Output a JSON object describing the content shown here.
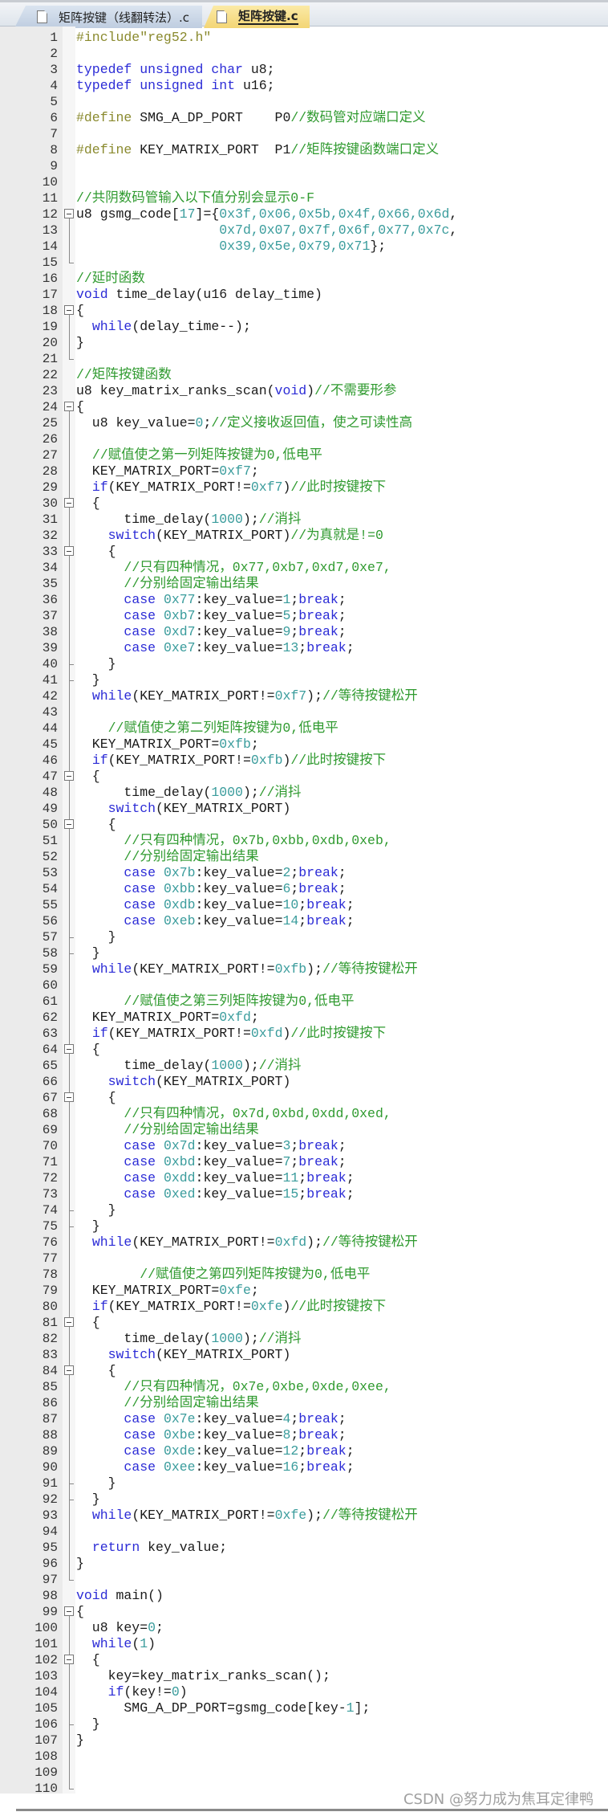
{
  "tabs": [
    {
      "label": "矩阵按键（线翻转法）.c",
      "active": false
    },
    {
      "label": "矩阵按键.c",
      "active": true
    }
  ],
  "watermark": "CSDN @努力成为焦耳定律鸭",
  "colors": {
    "keyword": "#2b2bd6",
    "number": "#3a9c9c",
    "comment": "#2f9a2f",
    "preprocessor": "#8a8a2e",
    "active_tab": "#f3d575"
  },
  "folding": {
    "ranges": [
      [
        12,
        15
      ],
      [
        18,
        21
      ],
      [
        24,
        97
      ],
      [
        99,
        110
      ]
    ],
    "collapse_boxes": [
      12,
      18,
      24,
      30,
      33,
      47,
      50,
      64,
      67,
      81,
      84,
      99,
      102
    ],
    "ticks": [
      40,
      41,
      57,
      58,
      74,
      75,
      91,
      92,
      106
    ]
  },
  "lines": [
    [
      [
        "p",
        "#include\"reg52.h\""
      ]
    ],
    [],
    [
      [
        "k",
        "typedef unsigned char"
      ],
      [
        "t",
        " u8;"
      ]
    ],
    [
      [
        "k",
        "typedef unsigned int"
      ],
      [
        "t",
        " u16;"
      ]
    ],
    [],
    [
      [
        "p",
        "#define"
      ],
      [
        "t",
        " SMG_A_DP_PORT    P0"
      ],
      [
        "c",
        "//数码管对应端口定义"
      ]
    ],
    [],
    [
      [
        "p",
        "#define"
      ],
      [
        "t",
        " KEY_MATRIX_PORT  P1"
      ],
      [
        "c",
        "//矩阵按键函数端口定义"
      ]
    ],
    [],
    [],
    [
      [
        "c",
        "//共阴数码管输入以下值分别会显示0-F"
      ]
    ],
    [
      [
        "t",
        "u8 gsmg_code["
      ],
      [
        "n",
        "17"
      ],
      [
        "t",
        "]={"
      ],
      [
        "n",
        "0x3f,0x06,0x5b,0x4f,0x66,0x6d"
      ],
      [
        "t",
        ","
      ]
    ],
    [
      [
        "t",
        "                  "
      ],
      [
        "n",
        "0x7d,0x07,0x7f,0x6f,0x77,0x7c"
      ],
      [
        "t",
        ","
      ]
    ],
    [
      [
        "t",
        "                  "
      ],
      [
        "n",
        "0x39,0x5e,0x79,0x71"
      ],
      [
        "t",
        "};"
      ]
    ],
    [],
    [
      [
        "c",
        "//延时函数"
      ]
    ],
    [
      [
        "k",
        "void"
      ],
      [
        "t",
        " time_delay(u16 delay_time)"
      ]
    ],
    [
      [
        "t",
        "{"
      ]
    ],
    [
      [
        "t",
        "  "
      ],
      [
        "k",
        "while"
      ],
      [
        "t",
        "(delay_time--);"
      ]
    ],
    [
      [
        "t",
        "}"
      ]
    ],
    [],
    [
      [
        "c",
        "//矩阵按键函数"
      ]
    ],
    [
      [
        "t",
        "u8 key_matrix_ranks_scan("
      ],
      [
        "k",
        "void"
      ],
      [
        "t",
        ")"
      ],
      [
        "c",
        "//不需要形参"
      ]
    ],
    [
      [
        "t",
        "{"
      ]
    ],
    [
      [
        "t",
        "  u8 key_value="
      ],
      [
        "n",
        "0"
      ],
      [
        "t",
        ";"
      ],
      [
        "c",
        "//定义接收返回值，使之可读性高"
      ]
    ],
    [],
    [
      [
        "t",
        "  "
      ],
      [
        "c",
        "//赋值使之第一列矩阵按键为0,低电平"
      ]
    ],
    [
      [
        "t",
        "  KEY_MATRIX_PORT="
      ],
      [
        "n",
        "0xf7"
      ],
      [
        "t",
        ";"
      ]
    ],
    [
      [
        "t",
        "  "
      ],
      [
        "k",
        "if"
      ],
      [
        "t",
        "(KEY_MATRIX_PORT!="
      ],
      [
        "n",
        "0xf7"
      ],
      [
        "t",
        ")"
      ],
      [
        "c",
        "//此时按键按下"
      ]
    ],
    [
      [
        "t",
        "  {"
      ]
    ],
    [
      [
        "t",
        "      time_delay("
      ],
      [
        "n",
        "1000"
      ],
      [
        "t",
        ");"
      ],
      [
        "c",
        "//消抖"
      ]
    ],
    [
      [
        "t",
        "    "
      ],
      [
        "k",
        "switch"
      ],
      [
        "t",
        "(KEY_MATRIX_PORT)"
      ],
      [
        "c",
        "//为真就是!=0"
      ]
    ],
    [
      [
        "t",
        "    {"
      ]
    ],
    [
      [
        "t",
        "      "
      ],
      [
        "c",
        "//只有四种情况，0x77,0xb7,0xd7,0xe7,"
      ]
    ],
    [
      [
        "t",
        "      "
      ],
      [
        "c",
        "//分别给固定输出结果"
      ]
    ],
    [
      [
        "t",
        "      "
      ],
      [
        "k",
        "case"
      ],
      [
        "t",
        " "
      ],
      [
        "n",
        "0x77"
      ],
      [
        "t",
        ":key_value="
      ],
      [
        "n",
        "1"
      ],
      [
        "t",
        ";"
      ],
      [
        "k",
        "break"
      ],
      [
        "t",
        ";"
      ]
    ],
    [
      [
        "t",
        "      "
      ],
      [
        "k",
        "case"
      ],
      [
        "t",
        " "
      ],
      [
        "n",
        "0xb7"
      ],
      [
        "t",
        ":key_value="
      ],
      [
        "n",
        "5"
      ],
      [
        "t",
        ";"
      ],
      [
        "k",
        "break"
      ],
      [
        "t",
        ";"
      ]
    ],
    [
      [
        "t",
        "      "
      ],
      [
        "k",
        "case"
      ],
      [
        "t",
        " "
      ],
      [
        "n",
        "0xd7"
      ],
      [
        "t",
        ":key_value="
      ],
      [
        "n",
        "9"
      ],
      [
        "t",
        ";"
      ],
      [
        "k",
        "break"
      ],
      [
        "t",
        ";"
      ]
    ],
    [
      [
        "t",
        "      "
      ],
      [
        "k",
        "case"
      ],
      [
        "t",
        " "
      ],
      [
        "n",
        "0xe7"
      ],
      [
        "t",
        ":key_value="
      ],
      [
        "n",
        "13"
      ],
      [
        "t",
        ";"
      ],
      [
        "k",
        "break"
      ],
      [
        "t",
        ";"
      ]
    ],
    [
      [
        "t",
        "    }"
      ]
    ],
    [
      [
        "t",
        "  }"
      ]
    ],
    [
      [
        "t",
        "  "
      ],
      [
        "k",
        "while"
      ],
      [
        "t",
        "(KEY_MATRIX_PORT!="
      ],
      [
        "n",
        "0xf7"
      ],
      [
        "t",
        ");"
      ],
      [
        "c",
        "//等待按键松开"
      ]
    ],
    [],
    [
      [
        "t",
        "    "
      ],
      [
        "c",
        "//赋值使之第二列矩阵按键为0,低电平"
      ]
    ],
    [
      [
        "t",
        "  KEY_MATRIX_PORT="
      ],
      [
        "n",
        "0xfb"
      ],
      [
        "t",
        ";"
      ]
    ],
    [
      [
        "t",
        "  "
      ],
      [
        "k",
        "if"
      ],
      [
        "t",
        "(KEY_MATRIX_PORT!="
      ],
      [
        "n",
        "0xfb"
      ],
      [
        "t",
        ")"
      ],
      [
        "c",
        "//此时按键按下"
      ]
    ],
    [
      [
        "t",
        "  {"
      ]
    ],
    [
      [
        "t",
        "      time_delay("
      ],
      [
        "n",
        "1000"
      ],
      [
        "t",
        ");"
      ],
      [
        "c",
        "//消抖"
      ]
    ],
    [
      [
        "t",
        "    "
      ],
      [
        "k",
        "switch"
      ],
      [
        "t",
        "(KEY_MATRIX_PORT)"
      ]
    ],
    [
      [
        "t",
        "    {"
      ]
    ],
    [
      [
        "t",
        "      "
      ],
      [
        "c",
        "//只有四种情况，0x7b,0xbb,0xdb,0xeb,"
      ]
    ],
    [
      [
        "t",
        "      "
      ],
      [
        "c",
        "//分别给固定输出结果"
      ]
    ],
    [
      [
        "t",
        "      "
      ],
      [
        "k",
        "case"
      ],
      [
        "t",
        " "
      ],
      [
        "n",
        "0x7b"
      ],
      [
        "t",
        ":key_value="
      ],
      [
        "n",
        "2"
      ],
      [
        "t",
        ";"
      ],
      [
        "k",
        "break"
      ],
      [
        "t",
        ";"
      ]
    ],
    [
      [
        "t",
        "      "
      ],
      [
        "k",
        "case"
      ],
      [
        "t",
        " "
      ],
      [
        "n",
        "0xbb"
      ],
      [
        "t",
        ":key_value="
      ],
      [
        "n",
        "6"
      ],
      [
        "t",
        ";"
      ],
      [
        "k",
        "break"
      ],
      [
        "t",
        ";"
      ]
    ],
    [
      [
        "t",
        "      "
      ],
      [
        "k",
        "case"
      ],
      [
        "t",
        " "
      ],
      [
        "n",
        "0xdb"
      ],
      [
        "t",
        ":key_value="
      ],
      [
        "n",
        "10"
      ],
      [
        "t",
        ";"
      ],
      [
        "k",
        "break"
      ],
      [
        "t",
        ";"
      ]
    ],
    [
      [
        "t",
        "      "
      ],
      [
        "k",
        "case"
      ],
      [
        "t",
        " "
      ],
      [
        "n",
        "0xeb"
      ],
      [
        "t",
        ":key_value="
      ],
      [
        "n",
        "14"
      ],
      [
        "t",
        ";"
      ],
      [
        "k",
        "break"
      ],
      [
        "t",
        ";"
      ]
    ],
    [
      [
        "t",
        "    }"
      ]
    ],
    [
      [
        "t",
        "  }"
      ]
    ],
    [
      [
        "t",
        "  "
      ],
      [
        "k",
        "while"
      ],
      [
        "t",
        "(KEY_MATRIX_PORT!="
      ],
      [
        "n",
        "0xfb"
      ],
      [
        "t",
        ");"
      ],
      [
        "c",
        "//等待按键松开"
      ]
    ],
    [],
    [
      [
        "t",
        "      "
      ],
      [
        "c",
        "//赋值使之第三列矩阵按键为0,低电平"
      ]
    ],
    [
      [
        "t",
        "  KEY_MATRIX_PORT="
      ],
      [
        "n",
        "0xfd"
      ],
      [
        "t",
        ";"
      ]
    ],
    [
      [
        "t",
        "  "
      ],
      [
        "k",
        "if"
      ],
      [
        "t",
        "(KEY_MATRIX_PORT!="
      ],
      [
        "n",
        "0xfd"
      ],
      [
        "t",
        ")"
      ],
      [
        "c",
        "//此时按键按下"
      ]
    ],
    [
      [
        "t",
        "  {"
      ]
    ],
    [
      [
        "t",
        "      time_delay("
      ],
      [
        "n",
        "1000"
      ],
      [
        "t",
        ");"
      ],
      [
        "c",
        "//消抖"
      ]
    ],
    [
      [
        "t",
        "    "
      ],
      [
        "k",
        "switch"
      ],
      [
        "t",
        "(KEY_MATRIX_PORT)"
      ]
    ],
    [
      [
        "t",
        "    {"
      ]
    ],
    [
      [
        "t",
        "      "
      ],
      [
        "c",
        "//只有四种情况，0x7d,0xbd,0xdd,0xed,"
      ]
    ],
    [
      [
        "t",
        "      "
      ],
      [
        "c",
        "//分别给固定输出结果"
      ]
    ],
    [
      [
        "t",
        "      "
      ],
      [
        "k",
        "case"
      ],
      [
        "t",
        " "
      ],
      [
        "n",
        "0x7d"
      ],
      [
        "t",
        ":key_value="
      ],
      [
        "n",
        "3"
      ],
      [
        "t",
        ";"
      ],
      [
        "k",
        "break"
      ],
      [
        "t",
        ";"
      ]
    ],
    [
      [
        "t",
        "      "
      ],
      [
        "k",
        "case"
      ],
      [
        "t",
        " "
      ],
      [
        "n",
        "0xbd"
      ],
      [
        "t",
        ":key_value="
      ],
      [
        "n",
        "7"
      ],
      [
        "t",
        ";"
      ],
      [
        "k",
        "break"
      ],
      [
        "t",
        ";"
      ]
    ],
    [
      [
        "t",
        "      "
      ],
      [
        "k",
        "case"
      ],
      [
        "t",
        " "
      ],
      [
        "n",
        "0xdd"
      ],
      [
        "t",
        ":key_value="
      ],
      [
        "n",
        "11"
      ],
      [
        "t",
        ";"
      ],
      [
        "k",
        "break"
      ],
      [
        "t",
        ";"
      ]
    ],
    [
      [
        "t",
        "      "
      ],
      [
        "k",
        "case"
      ],
      [
        "t",
        " "
      ],
      [
        "n",
        "0xed"
      ],
      [
        "t",
        ":key_value="
      ],
      [
        "n",
        "15"
      ],
      [
        "t",
        ";"
      ],
      [
        "k",
        "break"
      ],
      [
        "t",
        ";"
      ]
    ],
    [
      [
        "t",
        "    }"
      ]
    ],
    [
      [
        "t",
        "  }"
      ]
    ],
    [
      [
        "t",
        "  "
      ],
      [
        "k",
        "while"
      ],
      [
        "t",
        "(KEY_MATRIX_PORT!="
      ],
      [
        "n",
        "0xfd"
      ],
      [
        "t",
        ");"
      ],
      [
        "c",
        "//等待按键松开"
      ]
    ],
    [],
    [
      [
        "t",
        "        "
      ],
      [
        "c",
        "//赋值使之第四列矩阵按键为0,低电平"
      ]
    ],
    [
      [
        "t",
        "  KEY_MATRIX_PORT="
      ],
      [
        "n",
        "0xfe"
      ],
      [
        "t",
        ";"
      ]
    ],
    [
      [
        "t",
        "  "
      ],
      [
        "k",
        "if"
      ],
      [
        "t",
        "(KEY_MATRIX_PORT!="
      ],
      [
        "n",
        "0xfe"
      ],
      [
        "t",
        ")"
      ],
      [
        "c",
        "//此时按键按下"
      ]
    ],
    [
      [
        "t",
        "  {"
      ]
    ],
    [
      [
        "t",
        "      time_delay("
      ],
      [
        "n",
        "1000"
      ],
      [
        "t",
        ");"
      ],
      [
        "c",
        "//消抖"
      ]
    ],
    [
      [
        "t",
        "    "
      ],
      [
        "k",
        "switch"
      ],
      [
        "t",
        "(KEY_MATRIX_PORT)"
      ]
    ],
    [
      [
        "t",
        "    {"
      ]
    ],
    [
      [
        "t",
        "      "
      ],
      [
        "c",
        "//只有四种情况，0x7e,0xbe,0xde,0xee,"
      ]
    ],
    [
      [
        "t",
        "      "
      ],
      [
        "c",
        "//分别给固定输出结果"
      ]
    ],
    [
      [
        "t",
        "      "
      ],
      [
        "k",
        "case"
      ],
      [
        "t",
        " "
      ],
      [
        "n",
        "0x7e"
      ],
      [
        "t",
        ":key_value="
      ],
      [
        "n",
        "4"
      ],
      [
        "t",
        ";"
      ],
      [
        "k",
        "break"
      ],
      [
        "t",
        ";"
      ]
    ],
    [
      [
        "t",
        "      "
      ],
      [
        "k",
        "case"
      ],
      [
        "t",
        " "
      ],
      [
        "n",
        "0xbe"
      ],
      [
        "t",
        ":key_value="
      ],
      [
        "n",
        "8"
      ],
      [
        "t",
        ";"
      ],
      [
        "k",
        "break"
      ],
      [
        "t",
        ";"
      ]
    ],
    [
      [
        "t",
        "      "
      ],
      [
        "k",
        "case"
      ],
      [
        "t",
        " "
      ],
      [
        "n",
        "0xde"
      ],
      [
        "t",
        ":key_value="
      ],
      [
        "n",
        "12"
      ],
      [
        "t",
        ";"
      ],
      [
        "k",
        "break"
      ],
      [
        "t",
        ";"
      ]
    ],
    [
      [
        "t",
        "      "
      ],
      [
        "k",
        "case"
      ],
      [
        "t",
        " "
      ],
      [
        "n",
        "0xee"
      ],
      [
        "t",
        ":key_value="
      ],
      [
        "n",
        "16"
      ],
      [
        "t",
        ";"
      ],
      [
        "k",
        "break"
      ],
      [
        "t",
        ";"
      ]
    ],
    [
      [
        "t",
        "    }"
      ]
    ],
    [
      [
        "t",
        "  }"
      ]
    ],
    [
      [
        "t",
        "  "
      ],
      [
        "k",
        "while"
      ],
      [
        "t",
        "(KEY_MATRIX_PORT!="
      ],
      [
        "n",
        "0xfe"
      ],
      [
        "t",
        ");"
      ],
      [
        "c",
        "//等待按键松开"
      ]
    ],
    [],
    [
      [
        "t",
        "  "
      ],
      [
        "k",
        "return"
      ],
      [
        "t",
        " key_value;"
      ]
    ],
    [
      [
        "t",
        "}"
      ]
    ],
    [],
    [
      [
        "k",
        "void"
      ],
      [
        "t",
        " main()"
      ]
    ],
    [
      [
        "t",
        "{"
      ]
    ],
    [
      [
        "t",
        "  u8 key="
      ],
      [
        "n",
        "0"
      ],
      [
        "t",
        ";"
      ]
    ],
    [
      [
        "t",
        "  "
      ],
      [
        "k",
        "while"
      ],
      [
        "t",
        "("
      ],
      [
        "n",
        "1"
      ],
      [
        "t",
        ")"
      ]
    ],
    [
      [
        "t",
        "  {"
      ]
    ],
    [
      [
        "t",
        "    key=key_matrix_ranks_scan();"
      ]
    ],
    [
      [
        "t",
        "    "
      ],
      [
        "k",
        "if"
      ],
      [
        "t",
        "(key!="
      ],
      [
        "n",
        "0"
      ],
      [
        "t",
        ")"
      ]
    ],
    [
      [
        "t",
        "      SMG_A_DP_PORT=gsmg_code[key-"
      ],
      [
        "n",
        "1"
      ],
      [
        "t",
        "];"
      ]
    ],
    [
      [
        "t",
        "  }"
      ]
    ],
    [
      [
        "t",
        "}"
      ]
    ],
    [],
    [],
    []
  ]
}
